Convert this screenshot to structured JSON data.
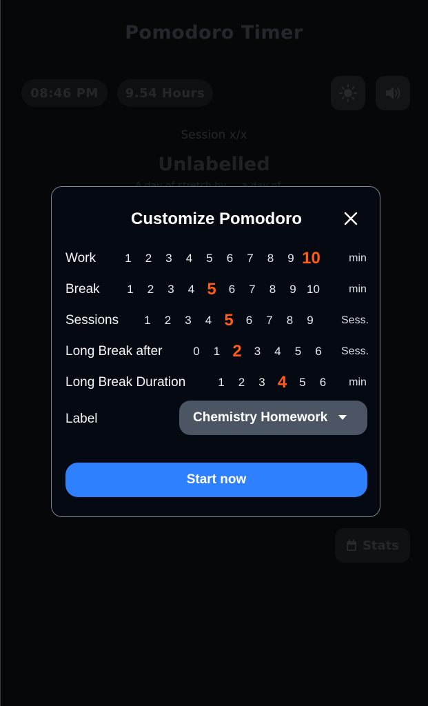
{
  "app": {
    "title": "Pomodoro Timer",
    "clock": "08:46 PM",
    "hours": "9.54 Hours",
    "theme_icon": "sun-icon",
    "sound_icon": "speaker-icon",
    "session": "Session x/x",
    "current_label": "Unlabelled",
    "quote_fragment": "A day of stretch by ... a day of ...",
    "stats_label": "Stats",
    "stats_icon": "calendar-icon"
  },
  "modal": {
    "title": "Customize Pomodoro",
    "close_icon": "close-icon",
    "accent_color": "#ff5a16",
    "rows": [
      {
        "label": "Work",
        "unit": "min",
        "options": [
          "1",
          "2",
          "3",
          "4",
          "5",
          "6",
          "7",
          "8",
          "9",
          "10"
        ],
        "selected": "10"
      },
      {
        "label": "Break",
        "unit": "min",
        "options": [
          "1",
          "2",
          "3",
          "4",
          "5",
          "6",
          "7",
          "8",
          "9",
          "10"
        ],
        "selected": "5"
      },
      {
        "label": "Sessions",
        "unit": "Sess.",
        "options": [
          "1",
          "2",
          "3",
          "4",
          "5",
          "6",
          "7",
          "8",
          "9"
        ],
        "selected": "5"
      },
      {
        "label": "Long Break after",
        "unit": "Sess.",
        "options": [
          "0",
          "1",
          "2",
          "3",
          "4",
          "5",
          "6"
        ],
        "selected": "2"
      },
      {
        "label": "Long Break Duration",
        "unit": "min",
        "options": [
          "1",
          "2",
          "3",
          "4",
          "5",
          "6"
        ],
        "selected": "4"
      }
    ],
    "label_field": {
      "label": "Label",
      "selected_value": "Chemistry Homework",
      "caret_icon": "caret-down-icon"
    },
    "start_button": {
      "label": "Start now",
      "color": "#2f80ff"
    }
  }
}
